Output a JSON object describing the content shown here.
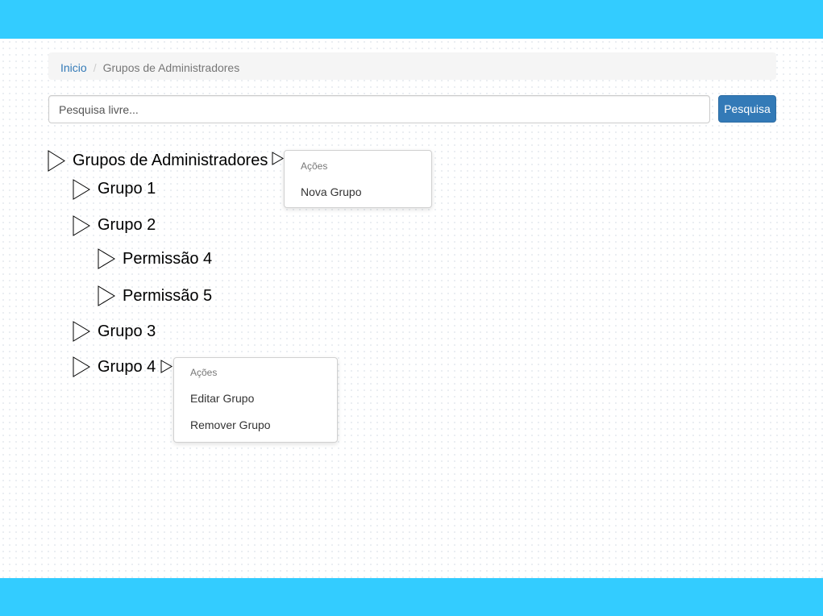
{
  "breadcrumb": {
    "home": "Inicio",
    "separator": "/",
    "current": "Grupos de Administradores"
  },
  "search": {
    "placeholder": "Pesquisa livre...",
    "value": "",
    "button_label": "Pesquisa"
  },
  "tree": {
    "root": "Grupos de Administradores",
    "grupo1": "Grupo 1",
    "grupo2": "Grupo 2",
    "permissao4": "Permissão 4",
    "permissao5": "Permissão 5",
    "grupo3": "Grupo 3",
    "grupo4": "Grupo 4"
  },
  "root_menu": {
    "header": "Ações",
    "items": [
      "Nova Grupo"
    ]
  },
  "grupo4_menu": {
    "header": "Ações",
    "items": [
      "Editar Grupo",
      "Remover Grupo"
    ]
  },
  "colors": {
    "header_bar": "#33ccff",
    "footer_bar": "#33ccff",
    "primary_button": "#337ab7",
    "link": "#337ab7"
  },
  "icons": {
    "tree_node": "triangle-right-outline-icon",
    "menu_toggle": "triangle-right-outline-icon"
  }
}
